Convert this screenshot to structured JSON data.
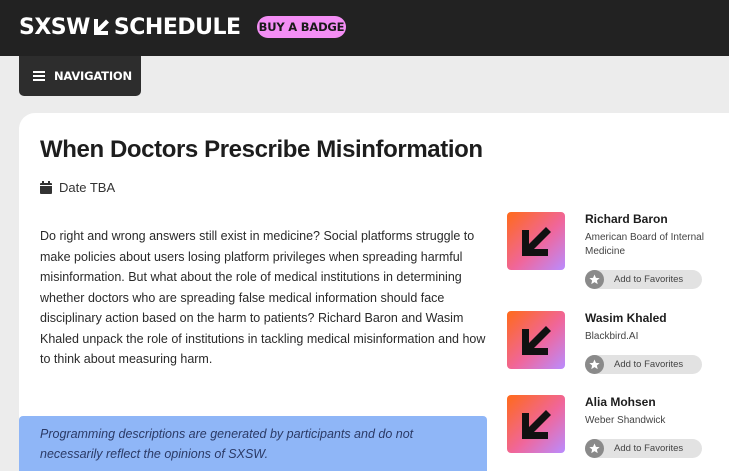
{
  "header": {
    "logo_left": "SXSW",
    "logo_right": "SCHEDULE",
    "buy_badge_label": "BUY A BADGE"
  },
  "nav": {
    "label": "NAVIGATION"
  },
  "session": {
    "title": "When Doctors Prescribe Misinformation",
    "date": "Date TBA",
    "description": "Do right and wrong answers still exist in medicine? Social platforms struggle to make policies about users losing platform privileges when spreading harmful misinformation. But what about the role of medical institutions in determining whether doctors who are spreading false medical information should face disciplinary action based on the harm to patients? Richard Baron and Wasim Khaled unpack the role of institutions in tackling medical misinformation and how to think about measuring harm.",
    "disclaimer": "Programming descriptions are generated by participants and do not necessarily reflect the opinions of SXSW."
  },
  "speakers": [
    {
      "name": "Richard Baron",
      "org": "American Board of Internal Medicine",
      "fav_label": "Add to Favorites"
    },
    {
      "name": "Wasim Khaled",
      "org": "Blackbird.AI",
      "fav_label": "Add to Favorites"
    },
    {
      "name": "Alia Mohsen",
      "org": "Weber Shandwick",
      "fav_label": "Add to Favorites"
    }
  ],
  "icons": {
    "menu": "hamburger-icon",
    "date": "calendar-icon",
    "favorite": "star-icon"
  },
  "colors": {
    "header_bg": "#222222",
    "badge_pink": "#f48ef5",
    "disclaimer_blue": "#8fb6f7"
  }
}
